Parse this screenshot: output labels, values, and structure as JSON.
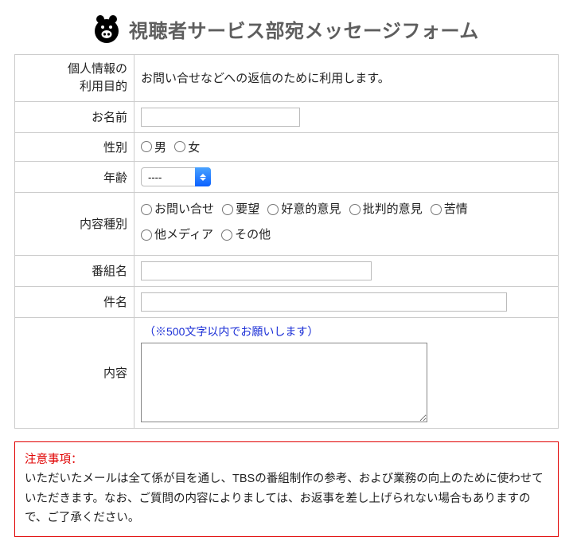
{
  "title": "視聴者サービス部宛メッセージフォーム",
  "rows": {
    "purpose_label": "個人情報の\n利用目的",
    "purpose_text": "お問い合せなどへの返信のために利用します。",
    "name_label": "お名前",
    "gender_label": "性別",
    "gender_options": [
      "男",
      "女"
    ],
    "age_label": "年齢",
    "age_selected": "----",
    "type_label": "内容種別",
    "type_options": [
      "お問い合せ",
      "要望",
      "好意的意見",
      "批判的意見",
      "苦情",
      "他メディア",
      "その他"
    ],
    "program_label": "番組名",
    "subject_label": "件名",
    "content_label": "内容",
    "content_hint": "（※500文字以内でお願いします）"
  },
  "notice": {
    "title": "注意事項：",
    "body": "いただいたメールは全て係が目を通し、TBSの番組制作の参考、および業務の向上のために使わせていただきます。なお、ご質問の内容によりましては、お返事を差し上げられない場合もありますので、ご了承ください。"
  }
}
